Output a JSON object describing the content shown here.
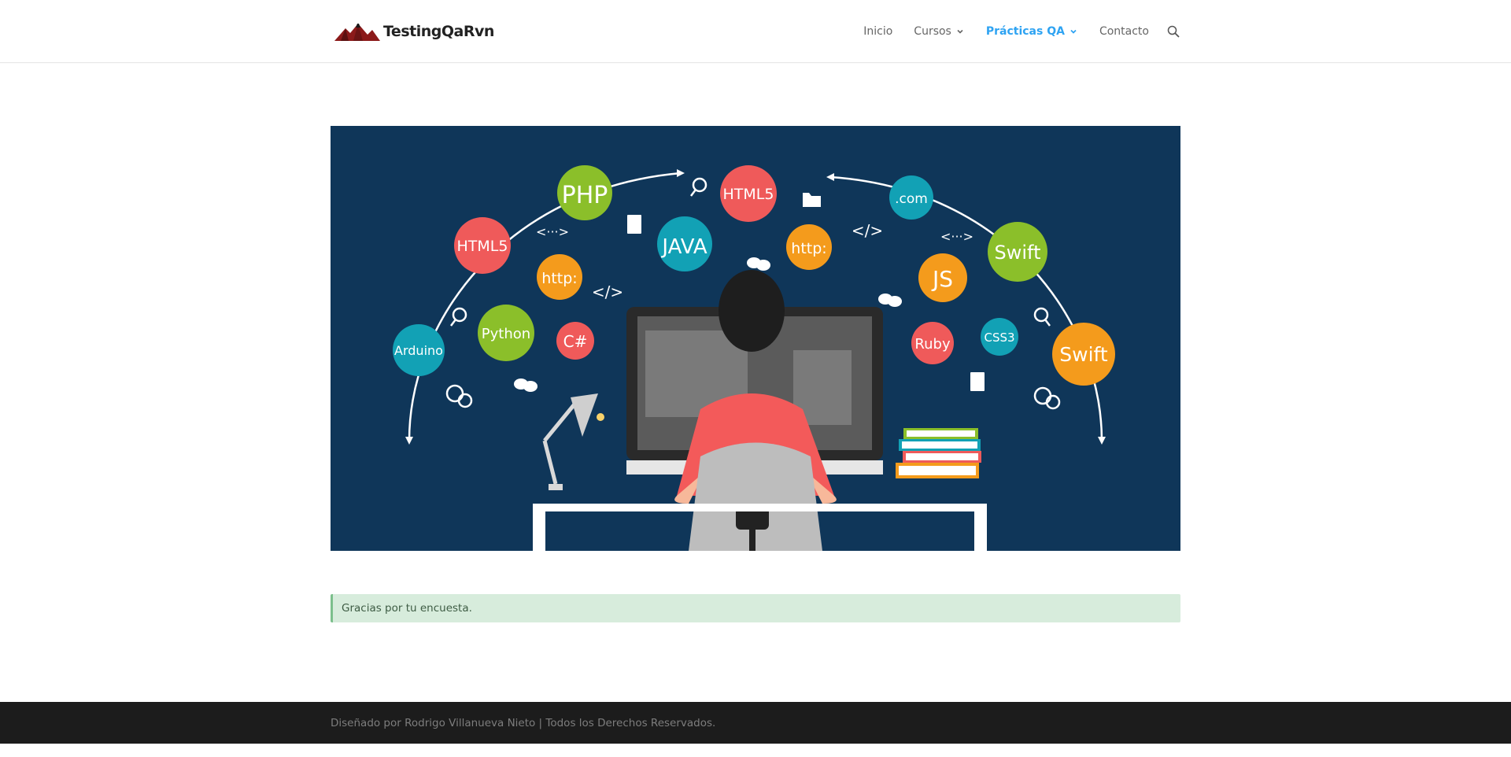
{
  "header": {
    "logo_text": "TestingQaRvn",
    "nav": [
      {
        "label": "Inicio",
        "has_dropdown": false,
        "active": false
      },
      {
        "label": "Cursos",
        "has_dropdown": true,
        "active": false
      },
      {
        "label": "Prácticas QA",
        "has_dropdown": true,
        "active": true
      },
      {
        "label": "Contacto",
        "has_dropdown": false,
        "active": false
      }
    ],
    "search_icon": "search-icon"
  },
  "hero": {
    "bubbles": [
      {
        "text": "PHP"
      },
      {
        "text": "HTML5"
      },
      {
        "text": "JAVA"
      },
      {
        "text": "http:"
      },
      {
        "text": ".com"
      },
      {
        "text": "Swift"
      },
      {
        "text": "HTML5"
      },
      {
        "text": "http:"
      },
      {
        "text": "JS"
      },
      {
        "text": "Python"
      },
      {
        "text": "C#"
      },
      {
        "text": "Ruby"
      },
      {
        "text": "CSS3"
      },
      {
        "text": "Arduino"
      },
      {
        "text": "Swift"
      }
    ],
    "symbols": [
      "<···>",
      "</>",
      "</>",
      "<···>"
    ]
  },
  "notice": {
    "text": "Gracias por tu encuesta."
  },
  "footer": {
    "text": "Diseñado por Rodrigo Villanueva Nieto | Todos los Derechos Reservados."
  },
  "colors": {
    "accent": "#2ea3f2",
    "hero_bg": "#0f3659",
    "notice_bg": "#d7ecdc",
    "footer_bg": "#1c1c1c"
  }
}
